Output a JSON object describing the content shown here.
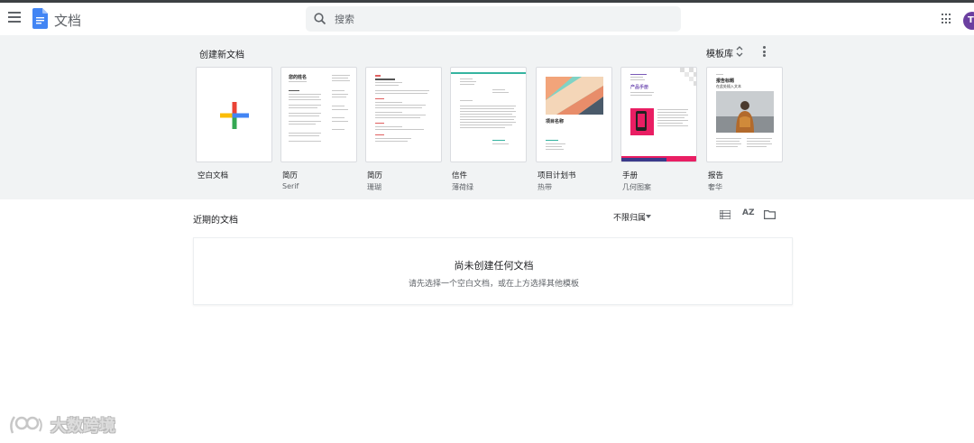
{
  "header": {
    "app_title": "文档",
    "search_placeholder": "搜索",
    "avatar_letter": "T"
  },
  "templates": {
    "section_title": "创建新文档",
    "gallery_label": "模板库",
    "items": [
      {
        "name": "空白文档",
        "sub": ""
      },
      {
        "name": "简历",
        "sub": "Serif"
      },
      {
        "name": "简历",
        "sub": "珊瑚"
      },
      {
        "name": "信件",
        "sub": "薄荷绿"
      },
      {
        "name": "项目计划书",
        "sub": "热带"
      },
      {
        "name": "手册",
        "sub": "几何图案"
      },
      {
        "name": "报告",
        "sub": "奢华"
      }
    ],
    "thumb_text": {
      "resume_name": "您的姓名",
      "project_title": "项目名称",
      "brochure_title": "产品手册",
      "report_title": "报告标题",
      "report_sub": "在此处插入文本"
    }
  },
  "recent": {
    "title": "近期的文档",
    "owner_filter": "不限归属",
    "sort_label": "AZ",
    "empty_title": "尚未创建任何文档",
    "empty_sub": "请先选择一个空白文档，或在上方选择其他模板"
  },
  "watermark": {
    "text": "大数跨境"
  },
  "colors": {
    "docs_blue": "#4285f4",
    "google_red": "#ea4335",
    "google_yellow": "#fbbc04",
    "google_green": "#34a853",
    "google_blue": "#4285f4",
    "avatar_purple": "#6b3fa0",
    "brochure_pink": "#e91e63",
    "mint": "#35b4a0"
  }
}
